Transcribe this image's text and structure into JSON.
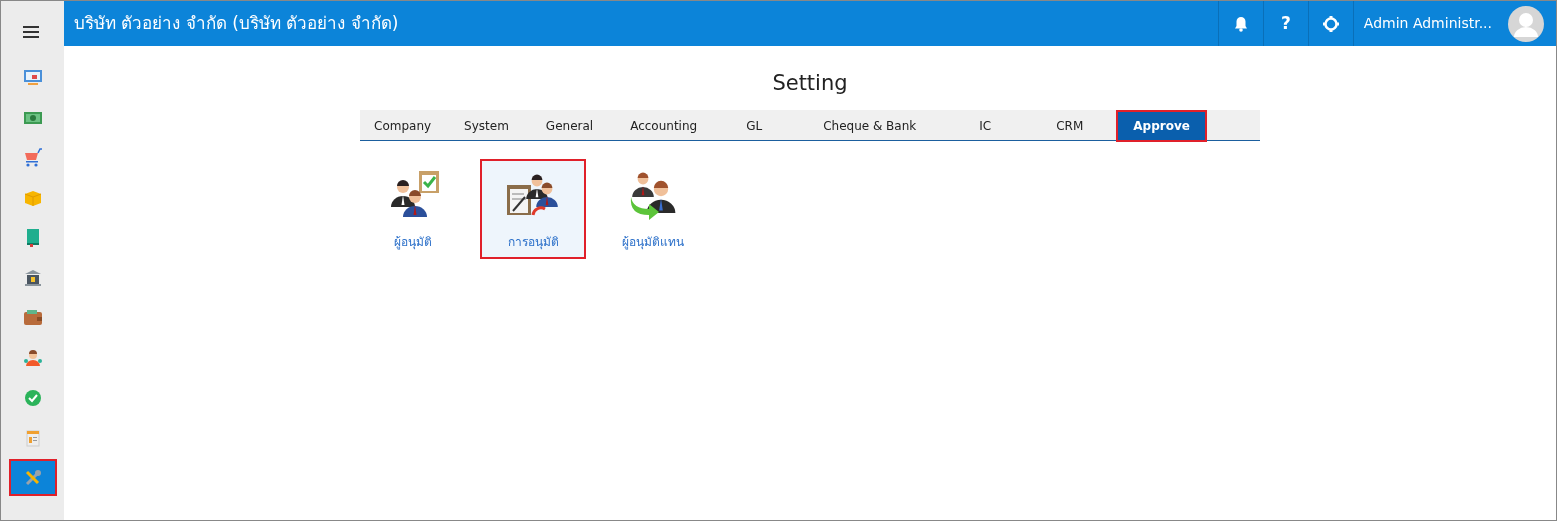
{
  "header": {
    "company": "บริษัท ตัวอย่าง จำกัด (บริษัท ตัวอย่าง จำกัด)",
    "user": "Admin Administr...",
    "help": "?"
  },
  "sidebar": {
    "items": [
      {
        "selected": false
      },
      {
        "selected": false
      },
      {
        "selected": false
      },
      {
        "selected": false
      },
      {
        "selected": false
      },
      {
        "selected": false
      },
      {
        "selected": false
      },
      {
        "selected": false
      },
      {
        "selected": false
      },
      {
        "selected": false
      },
      {
        "selected": true
      }
    ]
  },
  "page": {
    "title": "Setting"
  },
  "tabs": [
    {
      "label": "Company",
      "selected": false
    },
    {
      "label": "System",
      "selected": false
    },
    {
      "label": "General",
      "selected": false
    },
    {
      "label": "Accounting",
      "selected": false
    },
    {
      "label": "GL",
      "selected": false
    },
    {
      "label": "Cheque & Bank",
      "selected": false
    },
    {
      "label": "IC",
      "selected": false
    },
    {
      "label": "CRM",
      "selected": false
    },
    {
      "label": "Approve",
      "selected": true
    }
  ],
  "settings": [
    {
      "label": "ผู้อนุมัติ",
      "selected": false
    },
    {
      "label": "การอนุมัติ",
      "selected": true
    },
    {
      "label": "ผู้อนุมัติแทน",
      "selected": false
    }
  ]
}
